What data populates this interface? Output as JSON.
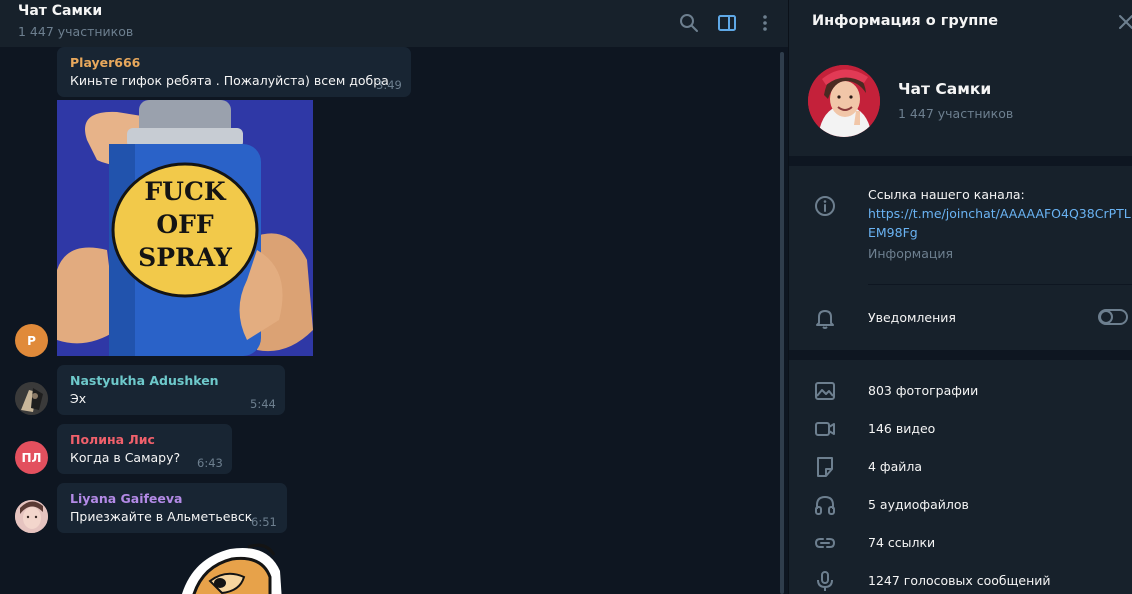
{
  "colors": {
    "bg": "#0e1621",
    "panel": "#17212b",
    "bubble": "#182533",
    "muted": "#6d7f8f",
    "link": "#6ab3f3",
    "accent_icon": "#5fa8e6"
  },
  "header": {
    "title": "Чат Самки",
    "subtitle": "1 447 участников",
    "icons": [
      "search-icon",
      "sidebar-toggle-icon",
      "more-vertical-icon"
    ]
  },
  "messages": [
    {
      "sender": "Player666",
      "sender_color": "#e8a85c",
      "text": "Киньте гифок ребята . Пожалуйста) всем добра",
      "time": "3:49",
      "avatar_initial": "P",
      "avatar_color": "#e08a3a",
      "sticker_text": [
        "FUCK",
        "OFF",
        "SPRAY"
      ]
    },
    {
      "sender": "Nastyukha Adushken",
      "sender_color": "#6ec9cb",
      "text": "Эх",
      "time": "5:44"
    },
    {
      "sender": "Полина Лис",
      "sender_color": "#f0606b",
      "text": "Когда в Самару?",
      "time": "6:43",
      "avatar_initial": "ПЛ",
      "avatar_color": "#e3505e"
    },
    {
      "sender": "Liyana Gaifeeva",
      "sender_color": "#b38ae6",
      "text": "Приезжайте в Альметьевск",
      "time": "6:51"
    }
  ],
  "panel": {
    "title": "Информация о группе",
    "group_name": "Чат Самки",
    "group_count": "1 447 участников",
    "info_label": "Ссылка нашего канала:",
    "info_link_line1": "https://t.me/joinchat/AAAAAFO4Q38CrPTL",
    "info_link_line2": "EM98Fg",
    "info_caption": "Информация",
    "notifications_label": "Уведомления",
    "notifications_on": false,
    "media": [
      {
        "icon": "photo-icon",
        "label": "803 фотографии"
      },
      {
        "icon": "video-icon",
        "label": "146 видео"
      },
      {
        "icon": "file-icon",
        "label": "4 файла"
      },
      {
        "icon": "headphones-icon",
        "label": "5 аудиофайлов"
      },
      {
        "icon": "link-icon",
        "label": "74 ссылки"
      },
      {
        "icon": "microphone-icon",
        "label": "1247 голосовых сообщений"
      }
    ]
  }
}
